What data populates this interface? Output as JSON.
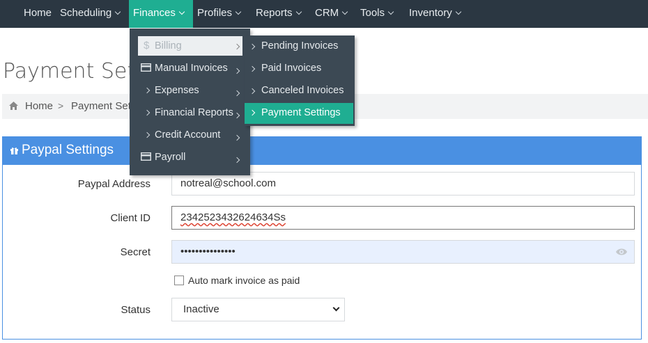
{
  "nav": {
    "items": [
      {
        "label": "Home"
      },
      {
        "label": "Scheduling"
      },
      {
        "label": "Finances"
      },
      {
        "label": "Profiles"
      },
      {
        "label": "Reports"
      },
      {
        "label": "CRM"
      },
      {
        "label": "Tools"
      },
      {
        "label": "Inventory"
      }
    ],
    "active": "Finances"
  },
  "page": {
    "title": "Payment Settings"
  },
  "breadcrumb": {
    "home": "Home",
    "separator": ">",
    "current": "Payment Settings"
  },
  "finances_menu": {
    "items": [
      {
        "label": "Billing",
        "icon": "dollar-icon"
      },
      {
        "label": "Manual Invoices",
        "icon": "card-icon"
      },
      {
        "label": "Expenses",
        "icon": "chevron-right-icon"
      },
      {
        "label": "Financial Reports",
        "icon": "chevron-right-icon"
      },
      {
        "label": "Credit Account",
        "icon": "chevron-right-icon"
      },
      {
        "label": "Payroll",
        "icon": "card-icon"
      }
    ]
  },
  "billing_submenu": {
    "items": [
      {
        "label": "Pending Invoices"
      },
      {
        "label": "Paid Invoices"
      },
      {
        "label": "Canceled Invoices"
      },
      {
        "label": "Payment Settings"
      }
    ],
    "active": "Payment Settings"
  },
  "panel": {
    "title": "Paypal Settings",
    "icon": "gift-icon"
  },
  "form": {
    "paypal_address_label": "Paypal Address",
    "paypal_address_value": "notreal@school.com",
    "client_id_label": "Client ID",
    "client_id_value": "2342523432624634Ss",
    "secret_label": "Secret",
    "secret_value": "•••••••••••••••",
    "auto_mark_label": "Auto mark invoice as paid",
    "auto_mark_checked": false,
    "status_label": "Status",
    "status_value": "Inactive"
  },
  "colors": {
    "nav_bg": "#2b3742",
    "accent_green": "#1fae92",
    "panel_blue": "#4a90e2",
    "menu_bg": "#3c4954"
  }
}
